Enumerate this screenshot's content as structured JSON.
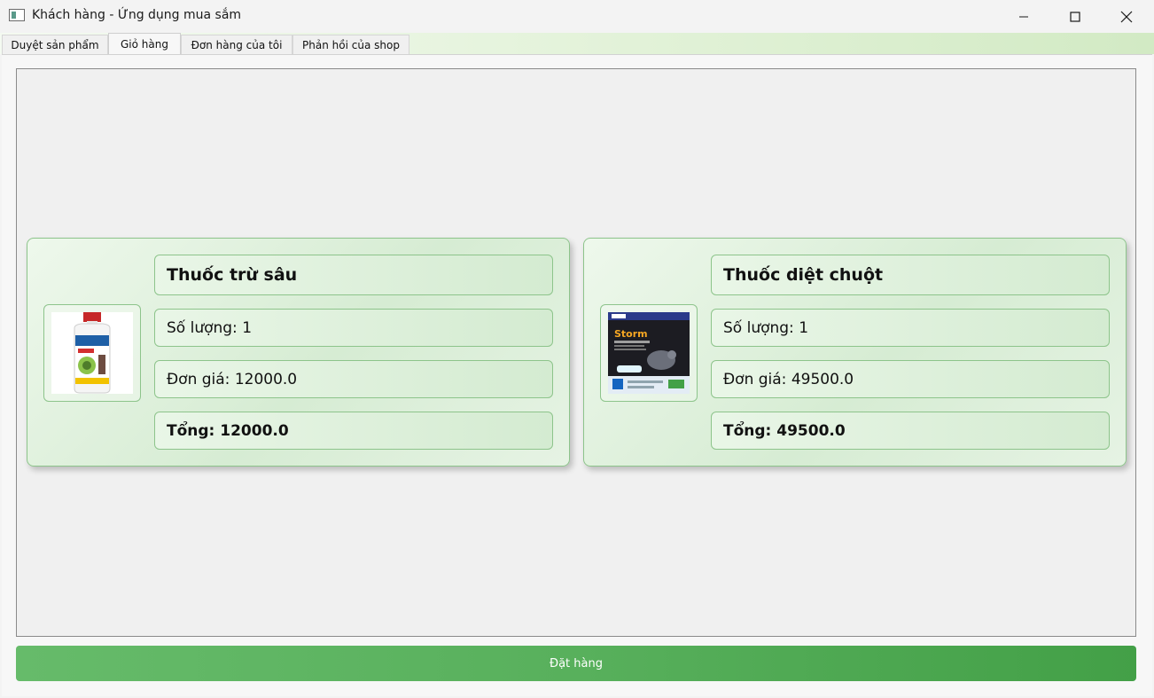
{
  "window": {
    "title": "Khách hàng - Ứng dụng mua sắm",
    "minimize_icon": "minimize-icon",
    "maximize_icon": "maximize-icon",
    "close_icon": "close-icon"
  },
  "tabs": [
    {
      "label": "Duyệt sản phẩm",
      "active": false
    },
    {
      "label": "Giỏ hàng",
      "active": true
    },
    {
      "label": "Đơn hàng của tôi",
      "active": false
    },
    {
      "label": "Phản hồi của shop",
      "active": false
    }
  ],
  "cart": {
    "items": [
      {
        "name": "Thuốc trừ sâu",
        "quantity": "Số lượng: 1",
        "unit_price": "Đơn giá: 12000.0",
        "total": "Tổng: 12000.0",
        "image": "pesticide-bottle-image"
      },
      {
        "name": "Thuốc diệt chuột",
        "quantity": "Số lượng: 1",
        "unit_price": "Đơn giá: 49500.0",
        "total": "Tổng: 49500.0",
        "image": "rodenticide-package-image",
        "brand_text": "Storm"
      }
    ]
  },
  "order_button": {
    "label": "Đặt hàng"
  },
  "colors": {
    "accent_green": "#66bb6a",
    "card_border": "#8dc48b",
    "button_end": "#43a047"
  }
}
